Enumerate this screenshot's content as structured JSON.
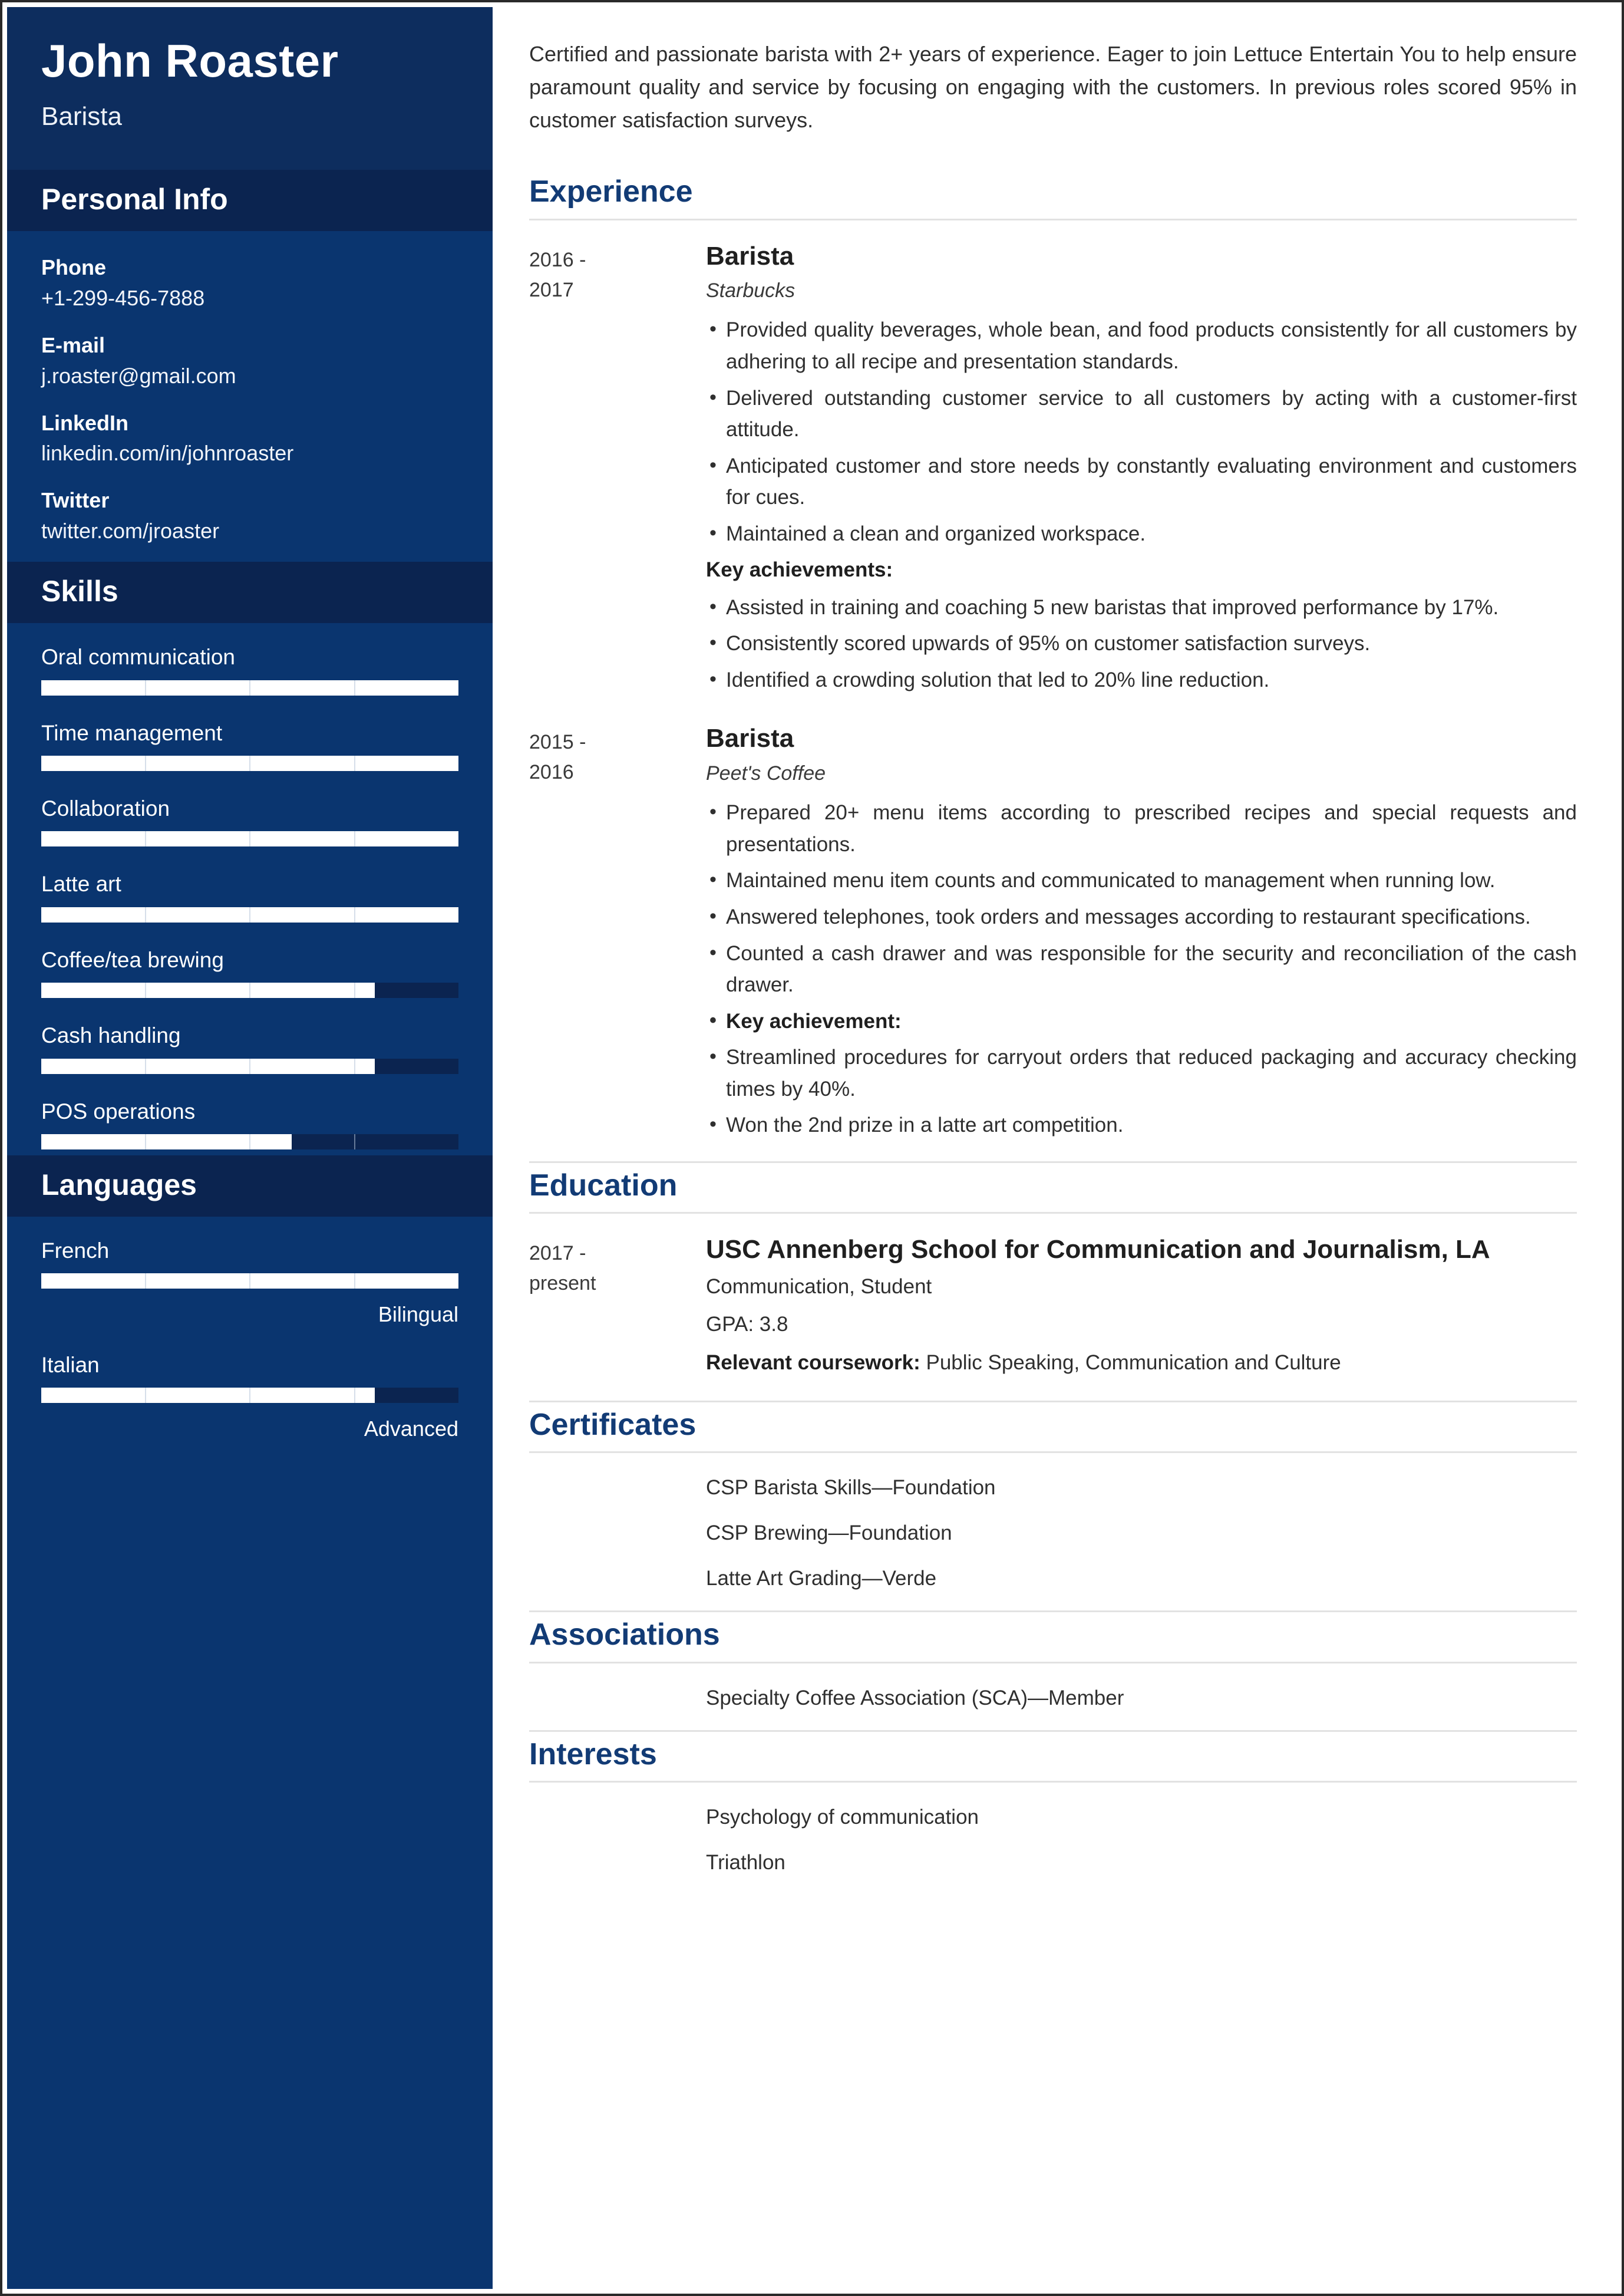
{
  "colors": {
    "sidebar_bg": "#0a356f",
    "sidebar_header_bg": "#0d2d5e",
    "sidebar_section_bg": "#0b2450",
    "accent_heading": "#123b75",
    "bar_fill": "#ffffff",
    "bar_track": "#0b2450",
    "rule": "#e2e2e2",
    "body_text": "#2f2f2f"
  },
  "sidebar": {
    "name": "John Roaster",
    "role": "Barista",
    "personal_info": {
      "title": "Personal Info",
      "items": [
        {
          "label": "Phone",
          "value": "+1-299-456-7888"
        },
        {
          "label": "E-mail",
          "value": "j.roaster@gmail.com"
        },
        {
          "label": "LinkedIn",
          "value": "linkedin.com/in/johnroaster"
        },
        {
          "label": "Twitter",
          "value": "twitter.com/jroaster"
        }
      ]
    },
    "skills": {
      "title": "Skills",
      "items": [
        {
          "label": "Oral communication",
          "percent": 100
        },
        {
          "label": "Time management",
          "percent": 100
        },
        {
          "label": "Collaboration",
          "percent": 100
        },
        {
          "label": "Latte art",
          "percent": 100
        },
        {
          "label": "Coffee/tea brewing",
          "percent": 80
        },
        {
          "label": "Cash handling",
          "percent": 80
        },
        {
          "label": "POS operations",
          "percent": 60
        }
      ]
    },
    "languages": {
      "title": "Languages",
      "items": [
        {
          "label": "French",
          "percent": 100,
          "level": "Bilingual"
        },
        {
          "label": "Italian",
          "percent": 80,
          "level": "Advanced"
        }
      ]
    }
  },
  "main": {
    "summary": "Certified and passionate barista with 2+ years of experience. Eager to join Lettuce Entertain You to help ensure paramount quality and service by focusing on engaging with the customers. In previous roles scored 95% in customer satisfaction surveys.",
    "experience": {
      "title": "Experience",
      "entries": [
        {
          "date_from": "2016 -",
          "date_to": "2017",
          "title": "Barista",
          "subtitle": "Starbucks",
          "bullets": [
            {
              "text": "Provided quality beverages, whole bean, and food products consistently for all customers by adhering to all recipe and presentation standards.",
              "style": "bullet"
            },
            {
              "text": "Delivered outstanding customer service to all customers by acting with a customer-first attitude.",
              "style": "bullet"
            },
            {
              "text": "Anticipated customer and store needs by constantly evaluating environment and customers for cues.",
              "style": "bullet"
            },
            {
              "text": "Maintained a clean and organized workspace.",
              "style": "bullet"
            },
            {
              "text": "Key achievements:",
              "style": "heading"
            },
            {
              "text": "Assisted in training and coaching 5 new baristas that improved performance by 17%.",
              "style": "bullet"
            },
            {
              "text": "Consistently scored upwards of 95% on customer satisfaction surveys.",
              "style": "bullet"
            },
            {
              "text": "Identified a crowding solution that led to 20% line reduction.",
              "style": "bullet"
            }
          ]
        },
        {
          "date_from": "2015 -",
          "date_to": "2016",
          "title": "Barista",
          "subtitle": "Peet's Coffee",
          "bullets": [
            {
              "text": "Prepared 20+ menu items according to prescribed recipes and special requests and presentations.",
              "style": "bullet"
            },
            {
              "text": "Maintained menu item counts and communicated to management when running low.",
              "style": "bullet"
            },
            {
              "text": "Answered telephones, took orders and messages according to restaurant specifications.",
              "style": "bullet"
            },
            {
              "text": "Counted a cash drawer and was responsible for the security and reconciliation of the cash drawer.",
              "style": "bullet"
            },
            {
              "text": "Key achievement:",
              "style": "bullet-bold"
            },
            {
              "text": "Streamlined procedures for carryout orders that reduced packaging and accuracy checking times by 40%.",
              "style": "bullet"
            },
            {
              "text": "Won the 2nd prize in a latte art competition.",
              "style": "bullet"
            }
          ]
        }
      ]
    },
    "education": {
      "title": "Education",
      "entries": [
        {
          "date_from": "2017 -",
          "date_to": "present",
          "title": "USC Annenberg School for Communication and Journalism, LA",
          "lines": [
            {
              "text": "Communication, Student",
              "bold_prefix": ""
            },
            {
              "text": "GPA: 3.8",
              "bold_prefix": ""
            },
            {
              "text": "Public Speaking, Communication and Culture",
              "bold_prefix": "Relevant coursework:"
            }
          ]
        }
      ]
    },
    "certificates": {
      "title": "Certificates",
      "items": [
        "CSP Barista Skills—Foundation",
        "CSP Brewing—Foundation",
        "Latte Art Grading—Verde"
      ]
    },
    "associations": {
      "title": "Associations",
      "items": [
        "Specialty Coffee Association (SCA)—Member"
      ]
    },
    "interests": {
      "title": "Interests",
      "items": [
        "Psychology of communication",
        "Triathlon"
      ]
    }
  }
}
